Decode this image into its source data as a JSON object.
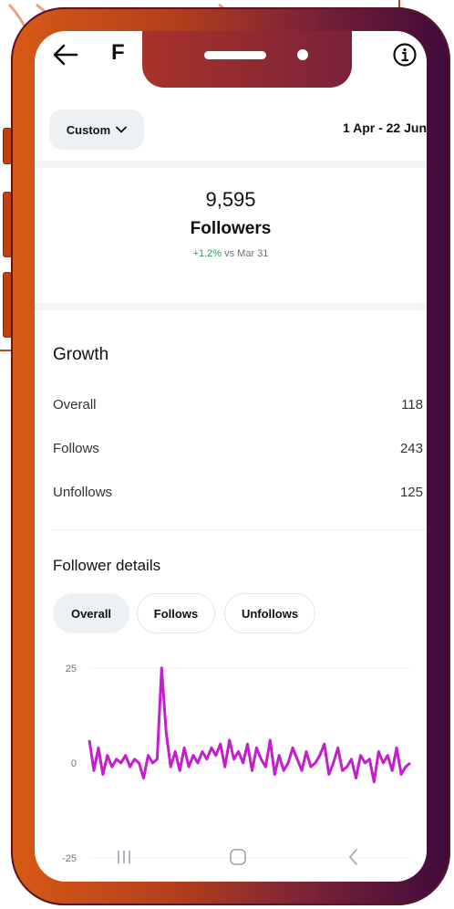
{
  "header": {
    "title_fragment": "F",
    "back_icon": "back-arrow-icon",
    "info_icon": "info-icon"
  },
  "filter": {
    "custom_label": "Custom",
    "date_range": "1 Apr - 22 Jun"
  },
  "summary": {
    "count": "9,595",
    "label": "Followers",
    "delta_value": "+1.2%",
    "delta_text": "vs Mar 31"
  },
  "growth": {
    "title": "Growth",
    "rows": [
      {
        "label": "Overall",
        "value": "118"
      },
      {
        "label": "Follows",
        "value": "243"
      },
      {
        "label": "Unfollows",
        "value": "125"
      }
    ]
  },
  "details": {
    "title": "Follower details",
    "tabs": [
      "Overall",
      "Follows",
      "Unfollows"
    ],
    "active_tab": "Overall"
  },
  "chart_data": {
    "type": "line",
    "yticks": [
      "25",
      "0",
      "-25"
    ],
    "ylim": [
      -25,
      25
    ],
    "grid": true,
    "series": [
      {
        "color": "#c51ecf",
        "values": [
          6,
          -2,
          4,
          -3,
          2,
          -1,
          1,
          0,
          2,
          -1,
          1,
          0,
          -4,
          2,
          0,
          1,
          25,
          8,
          -1,
          3,
          -2,
          4,
          -1,
          2,
          0,
          3,
          1,
          4,
          2,
          5,
          -1,
          6,
          1,
          3,
          0,
          5,
          -2,
          4,
          1,
          -1,
          6,
          -3,
          2,
          -2,
          0,
          4,
          1,
          -2,
          3,
          -1,
          0,
          2,
          5,
          -3,
          0,
          4,
          -2,
          -1,
          1,
          -4,
          2,
          0,
          1,
          -5,
          3,
          0,
          2,
          -2,
          4,
          -3,
          -1,
          0
        ]
      }
    ],
    "line_color": "#c51ecf"
  },
  "nav": {
    "recents_icon": "recents-icon",
    "home_icon": "home-icon",
    "back_icon": "nav-back-icon"
  }
}
